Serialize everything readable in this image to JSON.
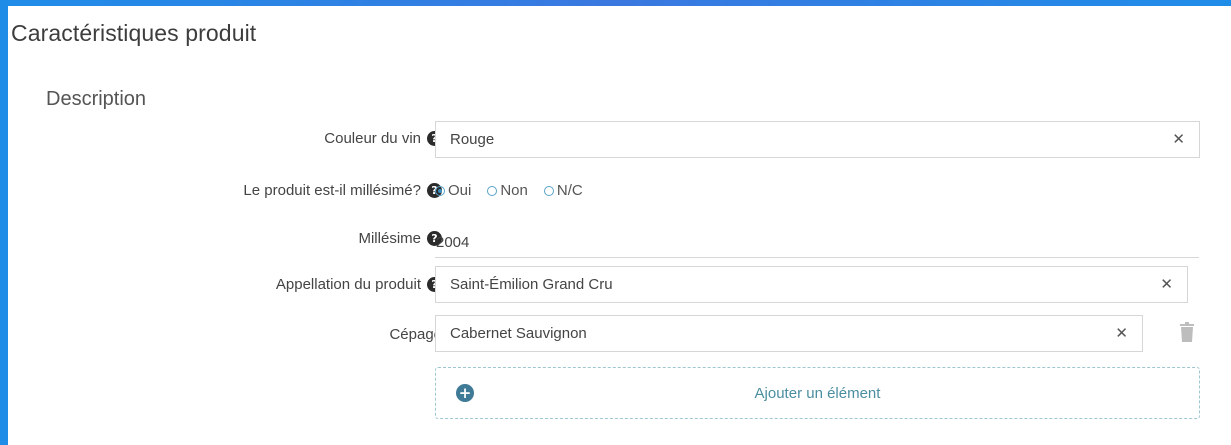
{
  "page": {
    "title": "Caractéristiques produit"
  },
  "section": {
    "title": "Description"
  },
  "fields": {
    "couleur": {
      "label": "Couleur du vin",
      "value": "Rouge"
    },
    "millesime_q": {
      "label": "Le produit est-il millésimé?",
      "options": [
        {
          "label": "Oui",
          "selected": true
        },
        {
          "label": "Non",
          "selected": false
        },
        {
          "label": "N/C",
          "selected": false
        }
      ]
    },
    "millesime": {
      "label": "Millésime",
      "value": "2004"
    },
    "appellation": {
      "label": "Appellation du produit",
      "value": "Saint-Émilion Grand Cru"
    },
    "cepage": {
      "label": "Cépage",
      "value": "Cabernet Sauvignon"
    }
  },
  "add": {
    "label": "Ajouter un élément"
  },
  "icons": {
    "help": "question-circle-icon",
    "clear": "close-icon",
    "delete": "trash-icon",
    "add": "plus-circle-icon"
  },
  "colors": {
    "frame": "#2a8ee6",
    "accent": "#3f7a96",
    "dashed_border": "#9ec7cf"
  }
}
